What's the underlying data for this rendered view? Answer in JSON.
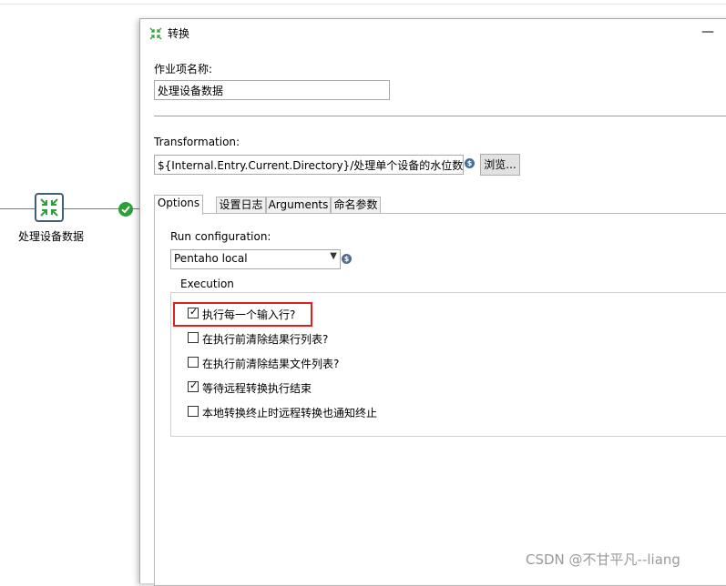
{
  "canvas": {
    "step_label": "处理设备数据",
    "step_icon": "transformation-icon",
    "hop_status_icon": "checkmark-icon",
    "hop_color": "#3aa53a"
  },
  "dialog": {
    "title": "转换",
    "title_icon": "transformation-icon",
    "minimize_label": "—",
    "jobentry_name_label": "作业项名称:",
    "jobentry_name_value": "处理设备数据",
    "transformation_label": "Transformation:",
    "transformation_value": "${Internal.Entry.Current.Directory}/处理单个设备的水位数据.",
    "variable_icon": "$",
    "browse_label": "浏览...",
    "tabs": [
      {
        "label": "Options",
        "active": true
      },
      {
        "label": "设置日志",
        "active": false
      },
      {
        "label": "Arguments",
        "active": false
      },
      {
        "label": "命名参数",
        "active": false
      }
    ],
    "run_config_label": "Run configuration:",
    "run_config_value": "Pentaho local",
    "execution_group_label": "Execution",
    "checkboxes": [
      {
        "label": "执行每一个输入行?",
        "checked": true
      },
      {
        "label": "在执行前清除结果行列表?",
        "checked": false
      },
      {
        "label": "在执行前清除结果文件列表?",
        "checked": false
      },
      {
        "label": "等待远程转换执行结束",
        "checked": true
      },
      {
        "label": "本地转换终止时远程转换也通知终止",
        "checked": false
      }
    ],
    "highlight_color": "#e02020"
  },
  "watermark": "CSDN @不甘平凡--liang"
}
